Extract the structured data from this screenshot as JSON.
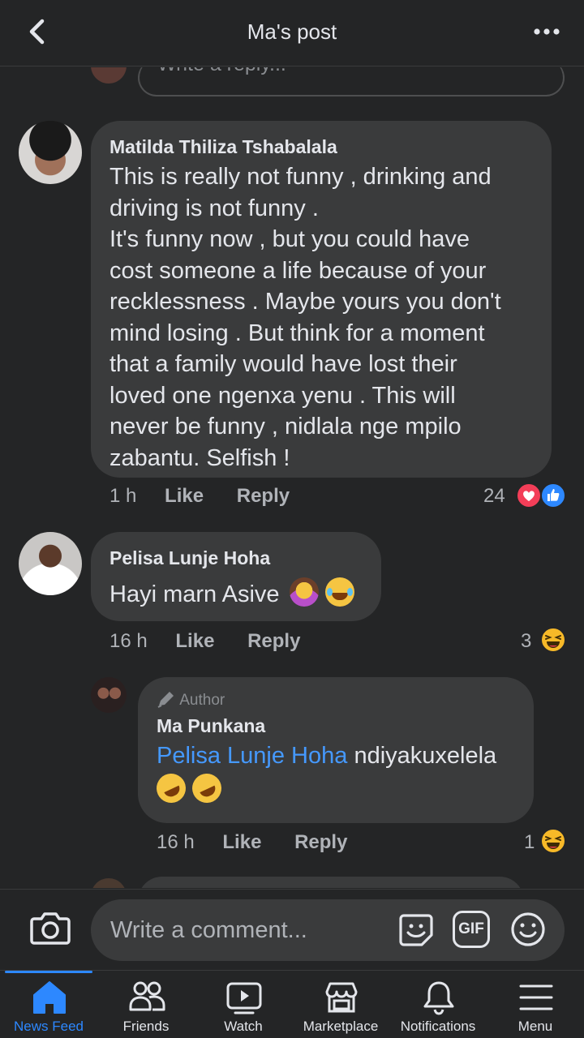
{
  "header": {
    "title": "Ma's post"
  },
  "reply_placeholder": "Write a reply...",
  "comments": [
    {
      "name": "Matilda Thiliza Tshabalala",
      "text_lines": [
        "This is really not funny , drinking and",
        "driving is not funny .",
        "It's funny now , but you could have",
        "cost someone a life because of your",
        "recklessness . Maybe yours you don't",
        "mind losing . But think for a moment",
        "that a family would have lost their",
        "loved one ngenxa yenu . This will",
        "never be funny , nidlala nge mpilo",
        "zabantu. Selfish !"
      ],
      "time": "1 h",
      "like": "Like",
      "reply": "Reply",
      "reactions_count": "24",
      "reactions": [
        "love",
        "like"
      ]
    },
    {
      "name": "Pelisa Lunje Hoha",
      "text": "Hayi marn Asive",
      "time": "16 h",
      "like": "Like",
      "reply": "Reply",
      "reactions_count": "3",
      "reactions": [
        "haha"
      ]
    }
  ],
  "author_reply": {
    "badge": "Author",
    "name": "Ma Punkana",
    "mention": "Pelisa Lunje Hoha",
    "text": " ndiyakuxelela",
    "time": "16 h",
    "like": "Like",
    "reply": "Reply",
    "reactions_count": "1",
    "reactions": [
      "haha"
    ]
  },
  "composer": {
    "placeholder": "Write a comment...",
    "gif_label": "GIF"
  },
  "tabs": [
    {
      "label": "News Feed",
      "icon": "home-icon",
      "active": true
    },
    {
      "label": "Friends",
      "icon": "friends-icon"
    },
    {
      "label": "Watch",
      "icon": "watch-icon"
    },
    {
      "label": "Marketplace",
      "icon": "marketplace-icon"
    },
    {
      "label": "Notifications",
      "icon": "bell-icon"
    },
    {
      "label": "Menu",
      "icon": "menu-icon"
    }
  ],
  "colors": {
    "accent": "#2d88ff",
    "bubble": "#3a3b3c",
    "background": "#242526",
    "mention": "#4599ff"
  }
}
